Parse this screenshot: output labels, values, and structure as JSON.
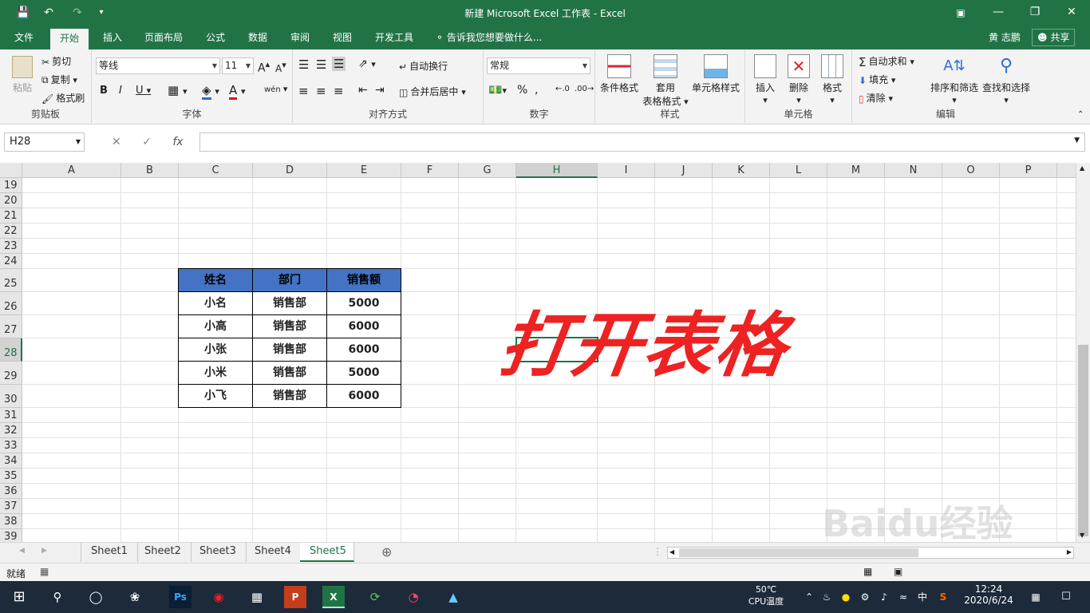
{
  "title_bar": {
    "title": "新建 Microsoft Excel 工作表 - Excel",
    "undo_icon": "undo-icon",
    "redo_icon": "redo-icon"
  },
  "tabs": [
    {
      "label": "文件"
    },
    {
      "label": "开始"
    },
    {
      "label": "插入"
    },
    {
      "label": "页面布局"
    },
    {
      "label": "公式"
    },
    {
      "label": "数据"
    },
    {
      "label": "审阅"
    },
    {
      "label": "视图"
    },
    {
      "label": "开发工具"
    }
  ],
  "tell_me": "告诉我您想要做什么...",
  "user_name": "黄 志鹏",
  "share_label": "共享",
  "ribbon": {
    "clipboard": {
      "label": "剪贴板",
      "paste": "粘贴",
      "cut": "剪切",
      "copy": "复制",
      "format_painter": "格式刷"
    },
    "font": {
      "label": "字体",
      "font_name": "等线",
      "font_size": "11"
    },
    "alignment": {
      "label": "对齐方式",
      "wrap": "自动换行",
      "merge": "合并后居中"
    },
    "number": {
      "label": "数字",
      "format": "常规"
    },
    "styles": {
      "label": "样式",
      "conditional": "条件格式",
      "table_line1": "套用",
      "table_line2": "表格格式",
      "cell_styles": "单元格样式"
    },
    "cells": {
      "label": "单元格",
      "insert": "插入",
      "delete": "删除",
      "format": "格式"
    },
    "editing": {
      "label": "编辑",
      "autosum": "自动求和",
      "fill": "填充",
      "clear": "清除",
      "sort": "排序和筛选",
      "find": "查找和选择"
    }
  },
  "formula_bar": {
    "name_box": "H28",
    "formula": ""
  },
  "columns": [
    "A",
    "B",
    "C",
    "D",
    "E",
    "F",
    "G",
    "H",
    "I",
    "J",
    "K",
    "L",
    "M",
    "N",
    "O",
    "P"
  ],
  "rows": [
    "19",
    "20",
    "21",
    "22",
    "23",
    "24",
    "25",
    "26",
    "27",
    "28",
    "29",
    "30",
    "31",
    "32",
    "33",
    "34",
    "35",
    "36",
    "37",
    "38",
    "39"
  ],
  "table": {
    "headers": [
      "姓名",
      "部门",
      "销售额"
    ],
    "rows": [
      [
        "小名",
        "销售部",
        "5000"
      ],
      [
        "小高",
        "销售部",
        "6000"
      ],
      [
        "小张",
        "销售部",
        "6000"
      ],
      [
        "小米",
        "销售部",
        "5000"
      ],
      [
        "小飞",
        "销售部",
        "6000"
      ]
    ]
  },
  "overlay_text": "打开表格",
  "sheets": [
    "Sheet1",
    "Sheet2",
    "Sheet3",
    "Sheet4",
    "Sheet5"
  ],
  "status": {
    "ready": "就绪"
  },
  "taskbar": {
    "temp": "50℃",
    "temp_label": "CPU温度",
    "ime": "中",
    "time": "12:24",
    "date": "2020/6/24"
  },
  "watermark": "Baidu经验",
  "colors": {
    "excel_green": "#217346",
    "header_blue": "#4472c4",
    "overlay_red": "#ee2222"
  }
}
